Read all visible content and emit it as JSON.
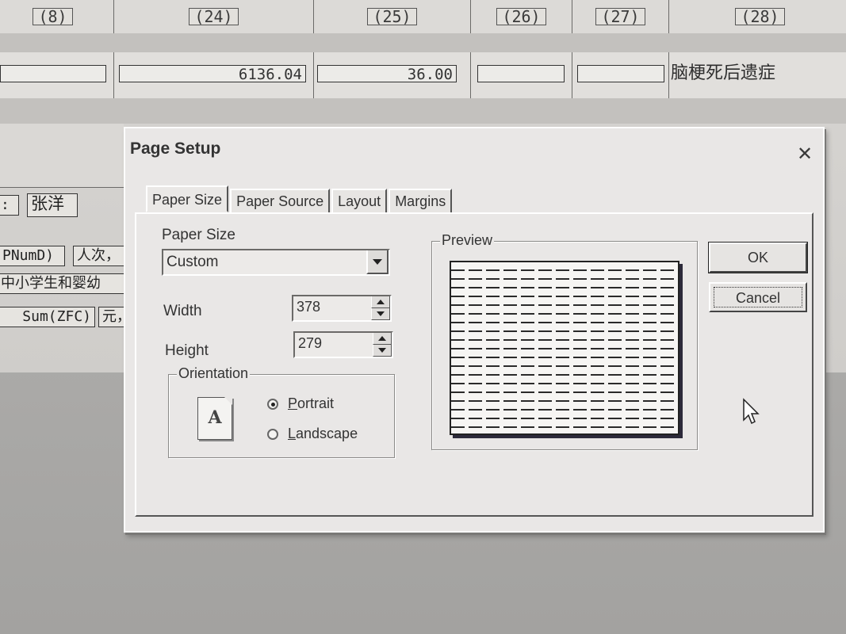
{
  "background_sheet": {
    "header_cells": [
      "(8)",
      "(24)",
      "(25)",
      "(26)",
      "(27)",
      "(28)"
    ],
    "row_values": [
      "6136.04",
      "36.00"
    ],
    "row_text": "脑梗死后遗症",
    "side_labels": [
      ":",
      "张洋",
      "PNumD)",
      "人次，",
      "中小学生和婴幼",
      "Sum(ZFC)",
      "元，"
    ]
  },
  "dialog": {
    "title": "Page Setup",
    "close_glyph": "✕",
    "tabs": [
      "Paper Size",
      "Paper Source",
      "Layout",
      "Margins"
    ],
    "paper_size": {
      "label": "Paper Size",
      "selected": "Custom"
    },
    "width": {
      "label": "Width",
      "value": "378"
    },
    "height": {
      "label": "Height",
      "value": "279"
    },
    "orientation": {
      "title": "Orientation",
      "icon_letter": "A",
      "portrait_pre": "",
      "portrait_ul": "P",
      "portrait_post": "ortrait",
      "landscape_pre": "",
      "landscape_ul": "L",
      "landscape_post": "andscape",
      "selected": "Portrait"
    },
    "preview": {
      "title": "Preview"
    },
    "buttons": {
      "ok": "OK",
      "cancel": "Cancel"
    }
  },
  "icons": [
    "close-icon",
    "dropdown-arrow-icon",
    "spin-up-icon",
    "spin-down-icon",
    "page-portrait-icon",
    "mouse-pointer-icon"
  ]
}
